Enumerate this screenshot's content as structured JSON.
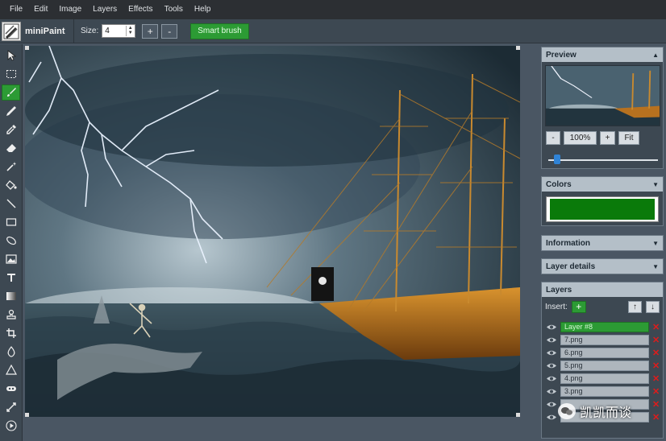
{
  "menu": {
    "items": [
      "File",
      "Edit",
      "Image",
      "Layers",
      "Effects",
      "Tools",
      "Help"
    ]
  },
  "toolbar": {
    "app_name": "miniPaint",
    "size_label": "Size:",
    "size_value": "4",
    "plus_label": "+",
    "minus_label": "-",
    "smart_brush_label": "Smart brush",
    "active_tool": "brush-icon"
  },
  "tools": [
    "select-icon",
    "rectangle-select-icon",
    "brush-icon",
    "pencil-icon",
    "color-picker-icon",
    "eraser-icon",
    "magic-wand-icon",
    "fill-icon",
    "line-icon",
    "rectangle-icon",
    "ellipse-icon",
    "image-icon",
    "text-icon",
    "gradient-icon",
    "clone-stamp-icon",
    "crop-icon",
    "blur-icon",
    "sharpen-icon",
    "bulge-icon",
    "replace-color-icon",
    "animation-play-icon"
  ],
  "preview": {
    "title": "Preview",
    "zoom_minus": "-",
    "zoom_value": "100%",
    "zoom_plus": "+",
    "fit_label": "Fit",
    "zoom_slider": 0.05
  },
  "colors": {
    "title": "Colors",
    "active_color": "#0a7a0a"
  },
  "information": {
    "title": "Information"
  },
  "layer_details": {
    "title": "Layer details"
  },
  "layers": {
    "title": "Layers",
    "insert_label": "Insert:",
    "insert_button": "+",
    "move_up": "↑",
    "move_down": "↓",
    "items": [
      {
        "name": "Layer #8",
        "selected": true
      },
      {
        "name": "7.png",
        "selected": false
      },
      {
        "name": "6.png",
        "selected": false
      },
      {
        "name": "5.png",
        "selected": false
      },
      {
        "name": "4.png",
        "selected": false
      },
      {
        "name": "3.png",
        "selected": false
      },
      {
        "name": "",
        "selected": false
      },
      {
        "name": "",
        "selected": false
      }
    ]
  },
  "watermark": {
    "text": "凯凯而谈"
  },
  "theme": {
    "accent_green": "#2c9b34",
    "panel_header": "#b4bfc8",
    "background": "#4a5663",
    "menubar": "#2c2f33",
    "delete_red": "#e01b1b"
  }
}
